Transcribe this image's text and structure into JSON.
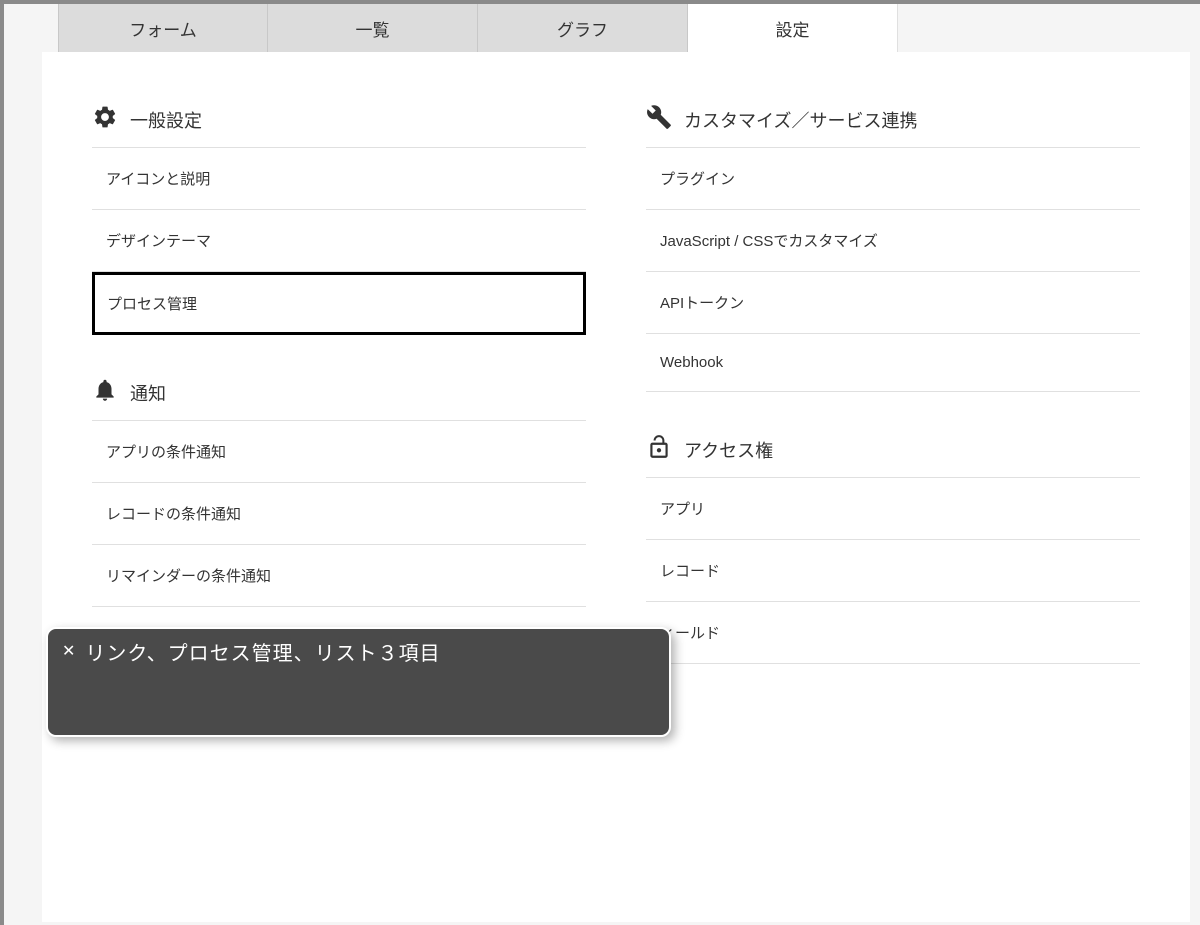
{
  "tabs": {
    "form": "フォーム",
    "list": "一覧",
    "graph": "グラフ",
    "settings": "設定"
  },
  "sections": {
    "general": {
      "title": "一般設定",
      "items": {
        "icon_desc": "アイコンと説明",
        "design_theme": "デザインテーマ",
        "process_mgmt": "プロセス管理"
      }
    },
    "notification": {
      "title": "通知",
      "items": {
        "app_condition": "アプリの条件通知",
        "record_condition": "レコードの条件通知",
        "reminder_condition": "リマインダーの条件通知"
      }
    },
    "customize": {
      "title": "カスタマイズ／サービス連携",
      "items": {
        "plugin": "プラグイン",
        "js_css": "JavaScript / CSSでカスタマイズ",
        "api_token": "APIトークン",
        "webhook": "Webhook"
      }
    },
    "access": {
      "title": "アクセス権",
      "items": {
        "app": "アプリ",
        "record": "レコード",
        "field": "ィールド"
      }
    }
  },
  "toast": {
    "text": "リンク、プロセス管理、リスト３項目"
  }
}
